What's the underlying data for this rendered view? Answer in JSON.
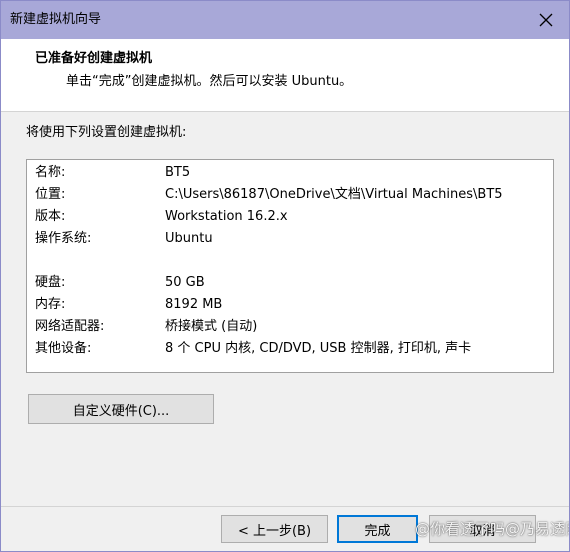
{
  "window": {
    "title": "新建虚拟机向导"
  },
  "header": {
    "title": "已准备好创建虚拟机",
    "subtitle": "单击“完成”创建虚拟机。然后可以安装 Ubuntu。"
  },
  "summary": {
    "label": "将使用下列设置创建虚拟机:",
    "rows": [
      {
        "key": "名称:",
        "value": "BT5"
      },
      {
        "key": "位置:",
        "value": "C:\\Users\\86187\\OneDrive\\文档\\Virtual Machines\\BT5"
      },
      {
        "key": "版本:",
        "value": "Workstation 16.2.x"
      },
      {
        "key": "操作系统:",
        "value": "Ubuntu"
      },
      {
        "key": "硬盘:",
        "value": "50 GB"
      },
      {
        "key": "内存:",
        "value": "8192 MB"
      },
      {
        "key": "网络适配器:",
        "value": "桥接模式 (自动)"
      },
      {
        "key": "其他设备:",
        "value": "8 个 CPU 内核, CD/DVD, USB 控制器, 打印机, 声卡"
      }
    ]
  },
  "buttons": {
    "customize": "自定义硬件(C)...",
    "back": "< 上一步(B)",
    "finish": "完成",
    "cancel": "取消"
  },
  "watermark": "@你看透了吗@乃易透网",
  "icons": {
    "close": "close-icon"
  }
}
